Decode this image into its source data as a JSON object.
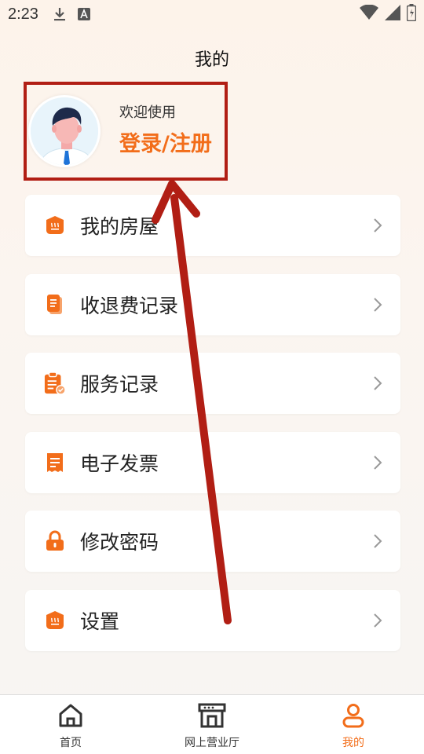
{
  "status_bar": {
    "time": "2:23",
    "icons_left": [
      "download-icon",
      "a-box-icon"
    ],
    "icons_right": [
      "wifi-icon",
      "signal-icon",
      "battery-icon"
    ]
  },
  "page": {
    "title": "我的"
  },
  "profile": {
    "welcome": "欢迎使用",
    "login_label": "登录/注册",
    "avatar": "male-avatar-icon"
  },
  "menu": {
    "items": [
      {
        "label": "我的房屋",
        "icon": "house-icon"
      },
      {
        "label": "收退费记录",
        "icon": "receipt-icon"
      },
      {
        "label": "服务记录",
        "icon": "clipboard-check-icon"
      },
      {
        "label": "电子发票",
        "icon": "invoice-icon"
      },
      {
        "label": "修改密码",
        "icon": "lock-icon"
      },
      {
        "label": "设置",
        "icon": "settings-house-icon"
      }
    ]
  },
  "tabbar": {
    "tabs": [
      {
        "label": "首页",
        "icon": "home-icon",
        "active": false
      },
      {
        "label": "网上营业厅",
        "icon": "store-icon",
        "active": false
      },
      {
        "label": "我的",
        "icon": "person-icon",
        "active": true
      }
    ]
  },
  "colors": {
    "accent": "#f26d1a",
    "highlight": "#b11e14",
    "background": "#fbf5f0"
  }
}
